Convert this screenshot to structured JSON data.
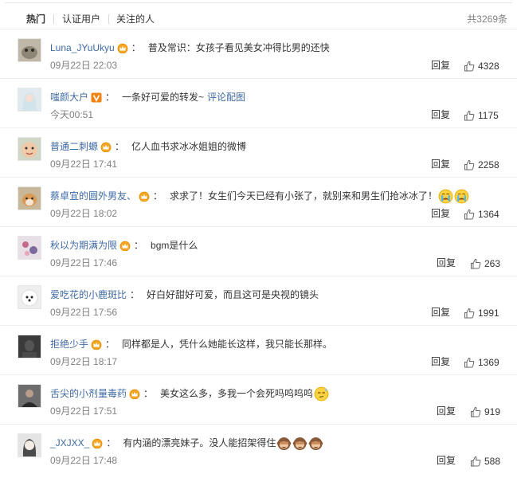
{
  "tabs": [
    {
      "label": "热门"
    },
    {
      "label": "认证用户"
    },
    {
      "label": "关注的人"
    }
  ],
  "total_label": "共3269条",
  "reply_label": "回复",
  "colors": {
    "link": "#3f6aa6",
    "muted": "#808080",
    "text": "#333333"
  },
  "comments": [
    {
      "user": "Luna_JYuUkyu",
      "badge": "crown-badge",
      "text": "普及常识：女孩子看见美女冲得比男的还快",
      "time": "09月22日 22:03",
      "likes": "4328",
      "avatar": "avatar-cat"
    },
    {
      "user": "嗤颜大户",
      "badge": "vip-v-badge",
      "text": "一条好可爱的转发~",
      "link": "评论配图",
      "time": "今天00:51",
      "likes": "1175",
      "avatar": "avatar-girl"
    },
    {
      "user": "普通二刺螈",
      "badge": "crown-badge",
      "text": "亿人血书求冰冰姐姐的微博",
      "time": "09月22日 17:41",
      "likes": "2258",
      "avatar": "avatar-baby"
    },
    {
      "user": "蔡卓宜的圆外男友、",
      "badge": "crown-badge",
      "text": "求求了！女生们今天已经有小张了，就别来和男生们抢冰冰了！",
      "emojis": [
        "crying-face",
        "crying-face"
      ],
      "time": "09月22日 18:02",
      "likes": "1364",
      "avatar": "avatar-dog"
    },
    {
      "user": "秋以为期满为限",
      "badge": "crown-badge",
      "text": "bgm是什么",
      "time": "09月22日 17:46",
      "likes": "263",
      "avatar": "avatar-flowers"
    },
    {
      "user": "爱吃花的小鹿斑比",
      "badge": "",
      "text": "好白好甜好可爱，而且这可是央视的镜头",
      "time": "09月22日 17:56",
      "likes": "1991",
      "avatar": "avatar-poodle"
    },
    {
      "user": "拒绝少手",
      "badge": "crown-badge",
      "text": "同样都是人，凭什么她能长这样，我只能长那样。",
      "time": "09月22日 18:17",
      "likes": "1369",
      "avatar": "avatar-dark"
    },
    {
      "user": "舌尖的小剂量毒药",
      "badge": "crown-badge",
      "text": "美女这么多，多我一个会死吗呜呜呜",
      "emojis": [
        "sweat-face"
      ],
      "time": "09月22日 17:51",
      "likes": "919",
      "avatar": "avatar-person"
    },
    {
      "user": "_JXJXX_",
      "badge": "crown-badge",
      "text": "有内涵的漂亮妹子。没人能招架得住",
      "emojis": [
        "monkey-face",
        "monkey-face",
        "monkey-face"
      ],
      "time": "09月22日 17:48",
      "likes": "588",
      "avatar": "avatar-anime"
    }
  ]
}
